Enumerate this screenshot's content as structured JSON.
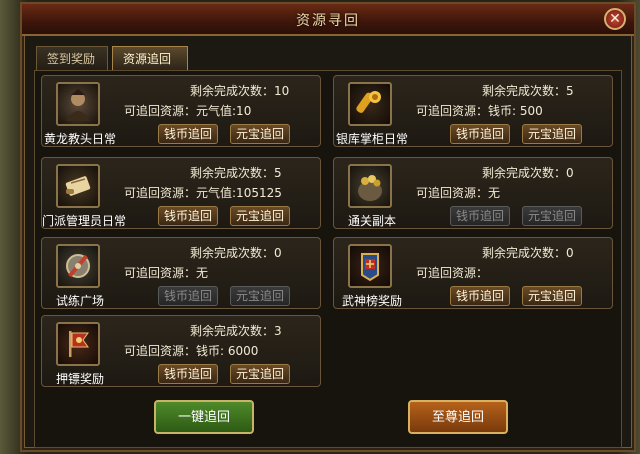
{
  "window": {
    "title": "资源寻回",
    "close_icon": "close-icon"
  },
  "tabs": [
    {
      "label": "签到奖励",
      "active": false
    },
    {
      "label": "资源追回",
      "active": true
    }
  ],
  "labels": {
    "remaining": "剩余完成次数：",
    "resource": "可追回资源：",
    "coin_button": "钱币追回",
    "ingot_button": "元宝追回"
  },
  "cards": [
    {
      "name": "黄龙教头日常",
      "icon": "warrior-portrait-icon",
      "remaining": "10",
      "resource": "元气值:10",
      "coin_enabled": true,
      "ingot_enabled": true
    },
    {
      "name": "银库掌柜日常",
      "icon": "gold-scroll-icon",
      "remaining": "5",
      "resource": "钱币: 500",
      "coin_enabled": true,
      "ingot_enabled": true
    },
    {
      "name": "门派管理员日常",
      "icon": "scroll-icon",
      "remaining": "5",
      "resource": "元气值:105125",
      "coin_enabled": true,
      "ingot_enabled": true
    },
    {
      "name": "通关副本",
      "icon": "treasure-sack-icon",
      "remaining": "0",
      "resource": "无",
      "coin_enabled": false,
      "ingot_enabled": false
    },
    {
      "name": "试练广场",
      "icon": "shield-sword-icon",
      "remaining": "0",
      "resource": "无",
      "coin_enabled": false,
      "ingot_enabled": false
    },
    {
      "name": "武神榜奖励",
      "icon": "martial-banner-icon",
      "remaining": "0",
      "resource": "",
      "coin_enabled": true,
      "ingot_enabled": true
    },
    {
      "name": "押镖奖励",
      "icon": "escort-flag-icon",
      "remaining": "3",
      "resource": "钱币: 6000",
      "coin_enabled": true,
      "ingot_enabled": true
    }
  ],
  "footer": {
    "one_click": "一键追回",
    "supreme": "至尊追回"
  },
  "colors": {
    "active_button": "#6a4a26",
    "disabled_button": "#3a3a3a",
    "green_button": "#4f8a2a",
    "orange_button": "#b5621a"
  }
}
